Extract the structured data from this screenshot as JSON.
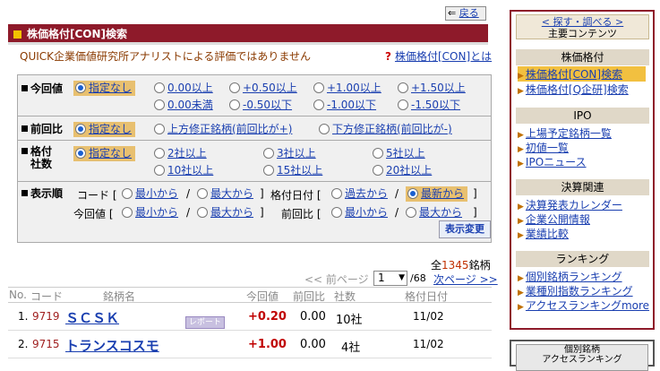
{
  "back_label": "戻る",
  "title": "株価格付[CON]検索",
  "note": "QUICK企業価値研究所アナリストによる評価ではありません",
  "help_link": "株価格付[CON]とは",
  "filters": {
    "current": {
      "label": "今回値",
      "options": [
        "指定なし",
        "0.00以上",
        "+0.50以上",
        "+1.00以上",
        "+1.50以上",
        "0.00未満",
        "-0.50以下",
        "-1.00以下",
        "-1.50以下"
      ],
      "selected": 0
    },
    "prev": {
      "label": "前回比",
      "options": [
        "指定なし",
        "上方修正銘柄(前回比が+)",
        "下方修正銘柄(前回比が-)"
      ],
      "selected": 0
    },
    "count": {
      "label1": "格付",
      "label2": "社数",
      "options": [
        "指定なし",
        "2社以上",
        "3社以上",
        "5社以上",
        "10社以上",
        "15社以上",
        "20社以上"
      ],
      "selected": 0
    },
    "order": {
      "label": "表示順",
      "code_label": "コード [",
      "date_label": "格付日付 [",
      "current_label": "今回値 [",
      "prev_label": "前回比 [",
      "asc": "最小から",
      "desc": "最大から",
      "past": "過去から",
      "latest": "最新から",
      "slash": "/",
      "close": "]"
    },
    "apply_button": "表示変更"
  },
  "total": {
    "prefix": "全",
    "count": "1345",
    "suffix": "銘柄"
  },
  "pager": {
    "prev": "<< 前ページ",
    "page": "1",
    "of": "/68",
    "next": "次ページ >>"
  },
  "columns": [
    "No.",
    "コード",
    "銘柄名",
    "今回値",
    "前回比",
    "社数",
    "格付日付"
  ],
  "rows": [
    {
      "no": "1.",
      "code": "9719",
      "name": "ＳＣＳＫ",
      "report": "レポート",
      "value": "+0.20",
      "diff": "0.00",
      "count": "10社",
      "date": "11/02"
    },
    {
      "no": "2.",
      "code": "9715",
      "name": "トランスコスモ",
      "report": "",
      "value": "+1.00",
      "diff": "0.00",
      "count": "4社",
      "date": "11/02"
    }
  ],
  "sidebar": {
    "top1": "< 探す・調べる >",
    "top2": "主要コンテンツ",
    "sections": [
      {
        "title": "株価格付",
        "items": [
          "株価格付[CON]検索",
          "株価格付[Q企研]検索"
        ]
      },
      {
        "title": "IPO",
        "items": [
          "上場予定銘柄一覧",
          "初値一覧",
          "IPOニュース"
        ]
      },
      {
        "title": "決算関連",
        "items": [
          "決算発表カレンダー",
          "企業公開情報",
          "業績比較"
        ]
      },
      {
        "title": "ランキング",
        "items": [
          "個別銘柄ランキング",
          "業種別指数ランキング",
          "アクセスランキングmore"
        ]
      }
    ],
    "box2_1": "個別銘柄",
    "box2_2": "アクセスランキング"
  }
}
